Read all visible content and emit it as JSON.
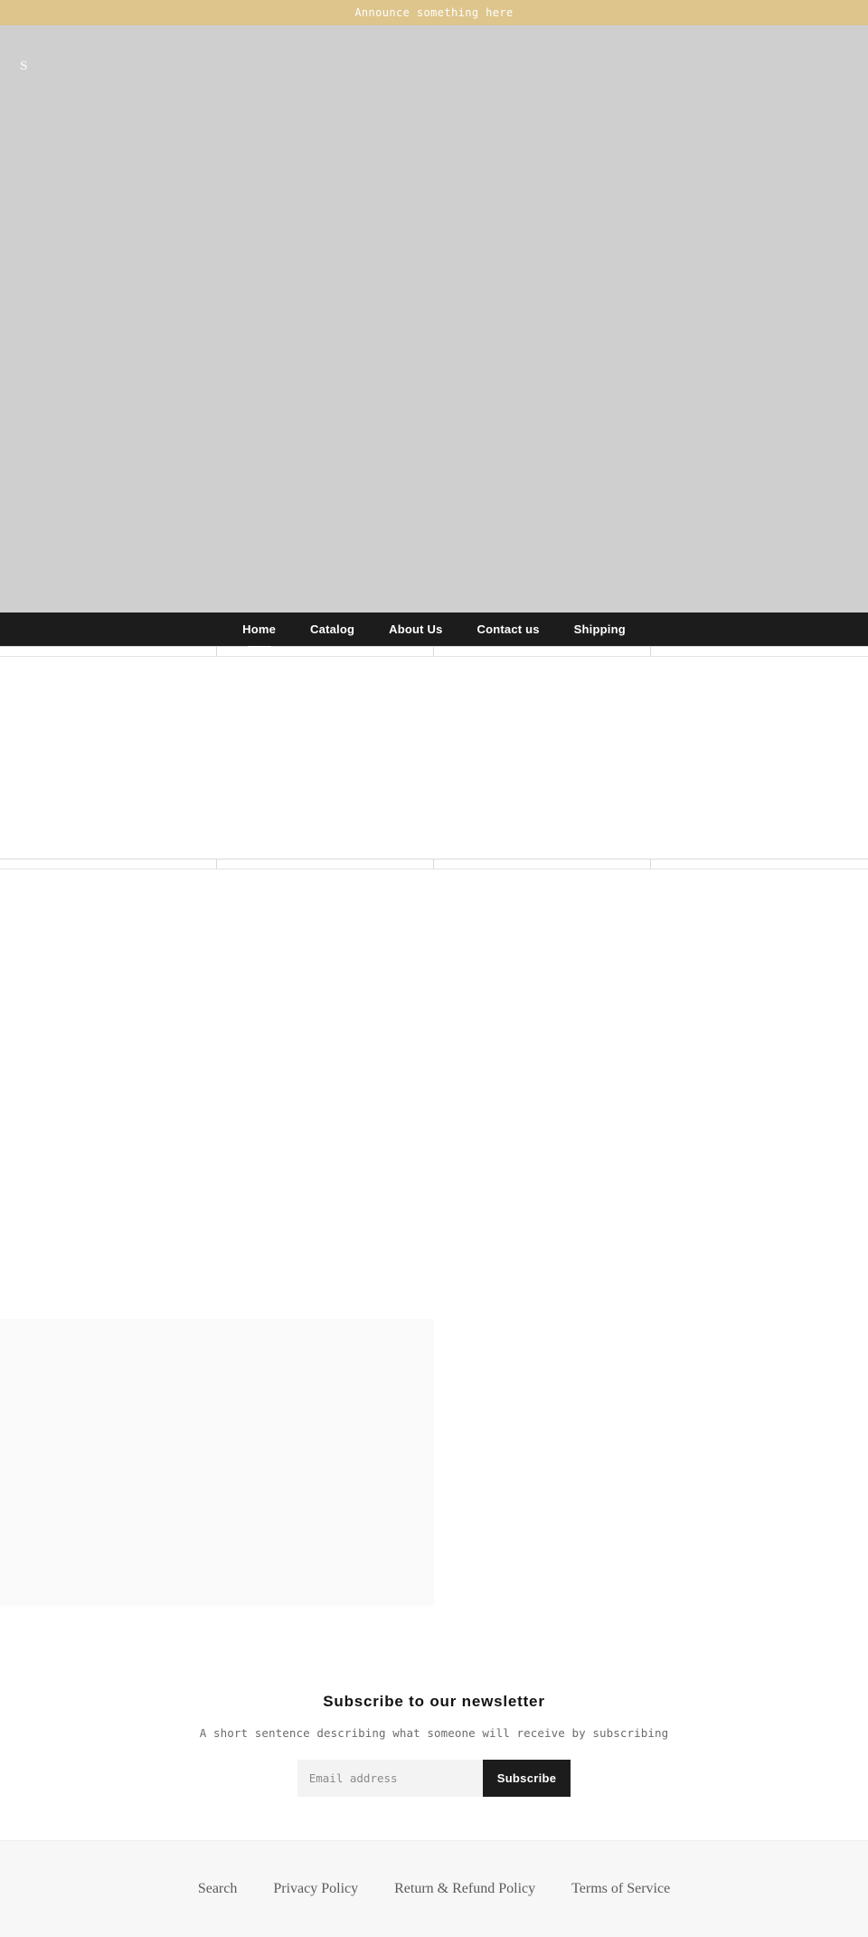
{
  "announcement": {
    "text": "Announce something here"
  },
  "hero": {
    "logo": "S",
    "background_color": "#cfcfcf"
  },
  "nav": {
    "background_color": "#1c1c1c",
    "items": [
      {
        "label": "Home",
        "active": true
      },
      {
        "label": "Catalog",
        "active": false
      },
      {
        "label": "About Us",
        "active": false
      },
      {
        "label": "Contact us",
        "active": false
      },
      {
        "label": "Shipping",
        "active": false
      }
    ]
  },
  "collection_grid_top": {
    "cells": [
      "",
      "",
      "",
      ""
    ]
  },
  "collection_grid_bottom": {
    "cells": [
      "",
      "",
      "",
      ""
    ]
  },
  "feature": {
    "background_color": "#fafafa"
  },
  "newsletter": {
    "heading": "Subscribe to our newsletter",
    "description": "A short sentence describing what someone will receive by subscribing",
    "email_placeholder": "Email address",
    "email_value": "",
    "submit_label": "Subscribe",
    "button_color": "#1c1c1c"
  },
  "footer": {
    "background_color": "#f7f7f7",
    "links": [
      {
        "label": "Search"
      },
      {
        "label": "Privacy Policy"
      },
      {
        "label": "Return & Refund Policy"
      },
      {
        "label": "Terms of Service"
      }
    ]
  },
  "theme": {
    "announcement_color": "#ddc58c",
    "accent_dark": "#1c1c1c"
  }
}
